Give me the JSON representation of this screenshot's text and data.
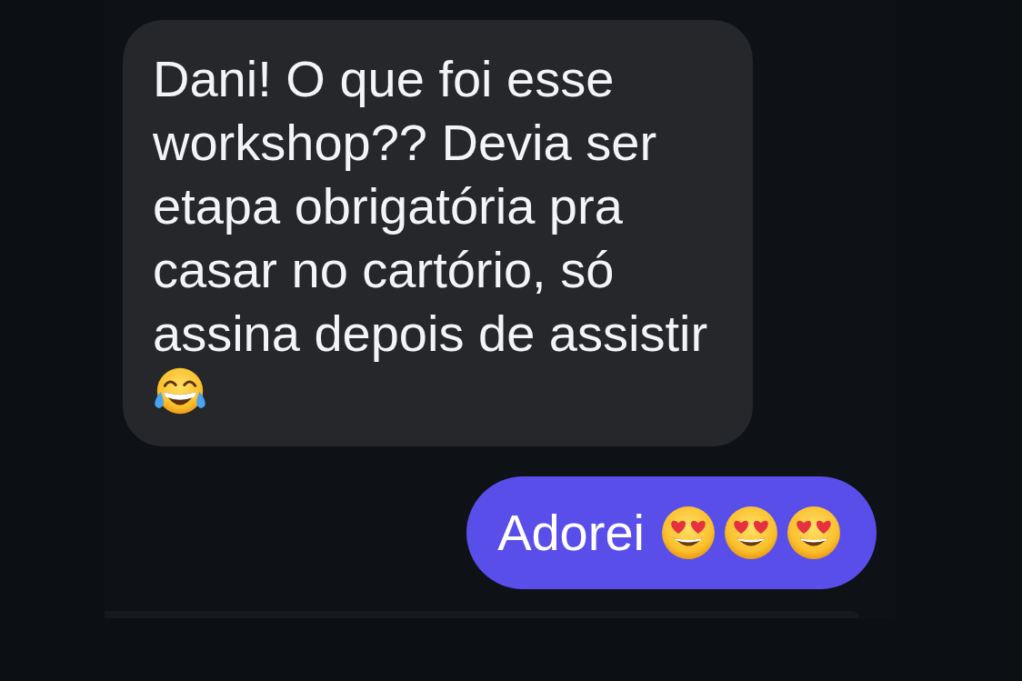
{
  "messages": [
    {
      "kind": "incoming",
      "text": "Dani! O que foi esse workshop?? Devia ser etapa obrigatória pra casar no cartório, só assina depois de assistir",
      "emojis": [
        {
          "kind": "tears_of_joy"
        }
      ]
    },
    {
      "kind": "outgoing",
      "text": "Adorei",
      "emojis": [
        {
          "kind": "heart_eyes"
        },
        {
          "kind": "heart_eyes"
        },
        {
          "kind": "heart_eyes"
        }
      ]
    }
  ]
}
